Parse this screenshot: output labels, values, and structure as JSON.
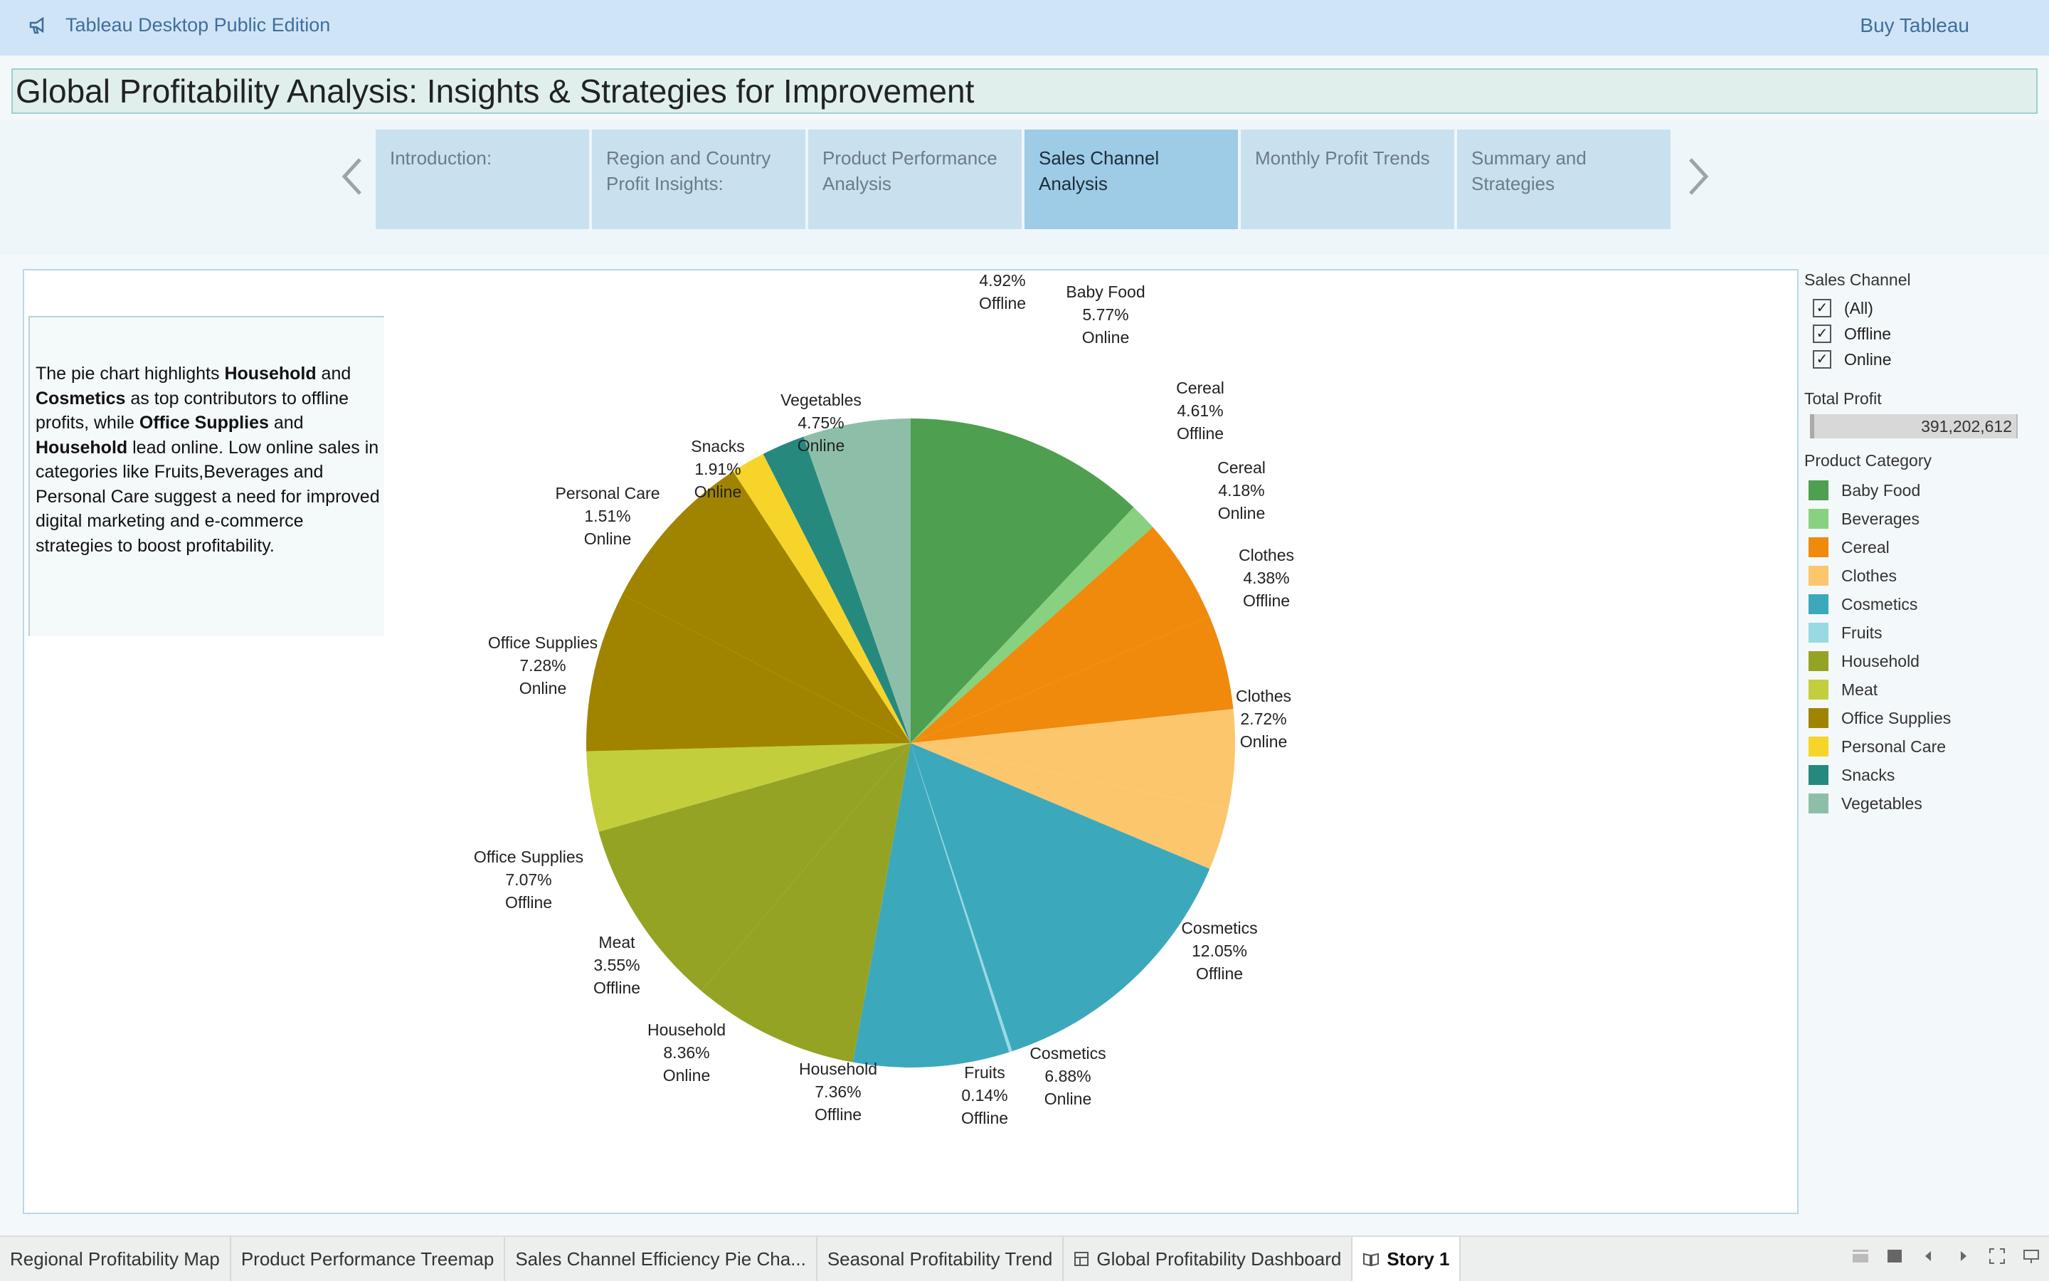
{
  "app": {
    "title": "Tableau Desktop Public Edition",
    "buy_label": "Buy Tableau",
    "icon": "megaphone-icon"
  },
  "story": {
    "title": "Global Profitability Analysis: Insights & Strategies for Improvement",
    "tabs": [
      {
        "label": "Introduction:",
        "active": false
      },
      {
        "label": "Region and Country Profit Insights:",
        "active": false
      },
      {
        "label": "Product Performance Analysis",
        "active": false
      },
      {
        "label": "Sales Channel Analysis",
        "active": true
      },
      {
        "label": "Monthly Profit Trends",
        "active": false
      },
      {
        "label": "Summary and Strategies",
        "active": false
      }
    ]
  },
  "annotation": {
    "p1": "The pie chart highlights ",
    "b1": "Household",
    "p2": " and ",
    "b2": "Cosmetics",
    "p3": " as top contributors to offline profits, while ",
    "b3": "Office Supplies",
    "p4": " and ",
    "b4": "Household",
    "p5": " lead online. Low online sales in categories like Fruits,Beverages and Personal Care suggest a need for improved digital marketing and e-commerce strategies to boost profitability."
  },
  "filters": {
    "sales_channel_header": "Sales Channel",
    "options": [
      "(All)",
      "Offline",
      "Online"
    ],
    "total_profit_header": "Total Profit",
    "total_profit_value": "391,202,612",
    "product_category_header": "Product Category"
  },
  "legend": [
    {
      "label": "Baby Food",
      "color": "#4e9f50"
    },
    {
      "label": "Beverages",
      "color": "#87d180"
    },
    {
      "label": "Cereal",
      "color": "#ef8a0c"
    },
    {
      "label": "Clothes",
      "color": "#fcc66d"
    },
    {
      "label": "Cosmetics",
      "color": "#3ca8bc"
    },
    {
      "label": "Fruits",
      "color": "#98d9e4"
    },
    {
      "label": "Household",
      "color": "#94a323"
    },
    {
      "label": "Meat",
      "color": "#c3ce3d"
    },
    {
      "label": "Office Supplies",
      "color": "#a08400"
    },
    {
      "label": "Personal Care",
      "color": "#f7d42a"
    },
    {
      "label": "Snacks",
      "color": "#26897e"
    },
    {
      "label": "Vegetables",
      "color": "#8dbfa8"
    }
  ],
  "chart_data": {
    "type": "pie",
    "slices": [
      {
        "category": "Baby Food",
        "channel": "Offline",
        "percent": 4.92,
        "color": "#4e9f50"
      },
      {
        "category": "Beverages",
        "channel": "",
        "percent": 1.2,
        "color": "#87d180",
        "label": false
      },
      {
        "category": "Baby Food",
        "channel": "Online",
        "percent": 5.77,
        "color": "#4e9f50",
        "label_only": true
      },
      {
        "category": "Cereal",
        "channel": "Offline",
        "percent": 4.61,
        "color": "#ef8a0c"
      },
      {
        "category": "Cereal",
        "channel": "Online",
        "percent": 4.18,
        "color": "#ef8a0c"
      },
      {
        "category": "Clothes",
        "channel": "Offline",
        "percent": 4.38,
        "color": "#fcc66d"
      },
      {
        "category": "Clothes",
        "channel": "Online",
        "percent": 2.72,
        "color": "#fcc66d"
      },
      {
        "category": "Cosmetics",
        "channel": "Offline",
        "percent": 12.05,
        "color": "#3ca8bc"
      },
      {
        "category": "Cosmetics",
        "channel": "Online",
        "percent": 6.88,
        "color": "#3ca8bc"
      },
      {
        "category": "Fruits",
        "channel": "Offline",
        "percent": 0.14,
        "color": "#98d9e4"
      },
      {
        "category": "Household",
        "channel": "Offline",
        "percent": 7.36,
        "color": "#94a323"
      },
      {
        "category": "Household",
        "channel": "Online",
        "percent": 8.36,
        "color": "#94a323"
      },
      {
        "category": "Meat",
        "channel": "Offline",
        "percent": 3.55,
        "color": "#c3ce3d"
      },
      {
        "category": "Office Supplies",
        "channel": "Offline",
        "percent": 7.07,
        "color": "#a08400"
      },
      {
        "category": "Office Supplies",
        "channel": "Online",
        "percent": 7.28,
        "color": "#a08400"
      },
      {
        "category": "Personal Care",
        "channel": "Online",
        "percent": 1.51,
        "color": "#f7d42a"
      },
      {
        "category": "Snacks",
        "channel": "Online",
        "percent": 1.91,
        "color": "#26897e"
      },
      {
        "category": "Vegetables",
        "channel": "Online",
        "percent": 4.75,
        "color": "#8dbfa8"
      }
    ]
  },
  "sheets": [
    {
      "label": "Regional Profitability Map",
      "active": false,
      "icon": ""
    },
    {
      "label": "Product Performance Treemap",
      "active": false,
      "icon": ""
    },
    {
      "label": "Sales Channel Efficiency Pie Cha...",
      "active": false,
      "icon": ""
    },
    {
      "label": "Seasonal Profitability Trend",
      "active": false,
      "icon": ""
    },
    {
      "label": "Global Profitability Dashboard",
      "active": false,
      "icon": "dashboard-icon"
    },
    {
      "label": "Story 1",
      "active": true,
      "icon": "story-icon"
    }
  ]
}
